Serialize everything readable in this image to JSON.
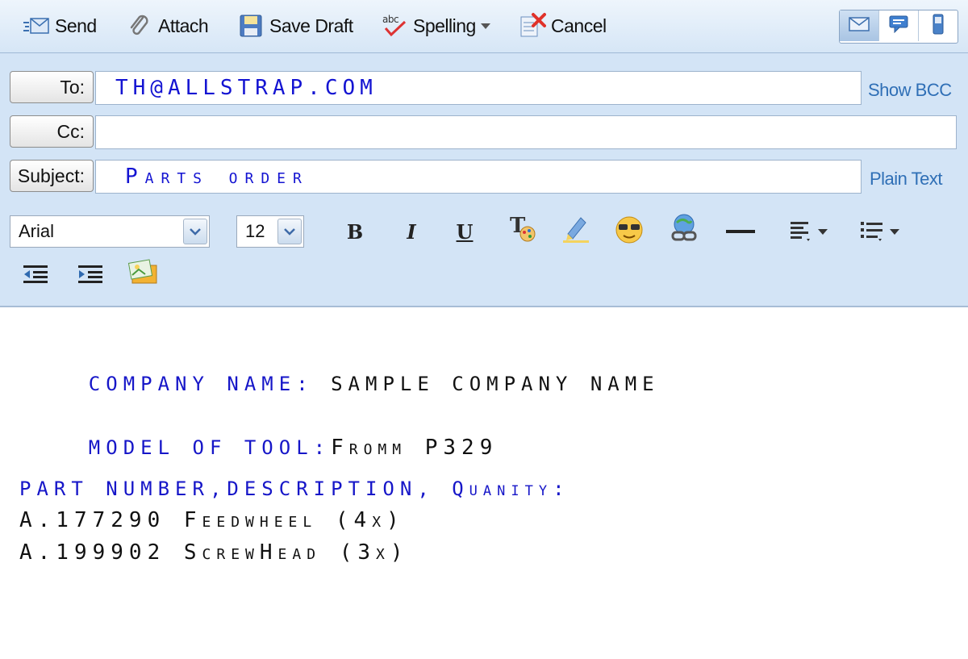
{
  "toolbar": {
    "send_label": "Send",
    "attach_label": "Attach",
    "save_draft_label": "Save Draft",
    "spelling_label": "Spelling",
    "cancel_label": "Cancel",
    "views": [
      "email-view-icon",
      "chat-view-icon",
      "mobile-view-icon"
    ]
  },
  "compose": {
    "to_label": "To:",
    "to_value": "TH@ALLSTRAP.COM",
    "cc_label": "Cc:",
    "cc_value": "",
    "subject_label": "Subject:",
    "subject_value": "Parts order",
    "show_bcc_label": "Show BCC",
    "plain_text_label": "Plain Text"
  },
  "format_bar": {
    "font": "Arial",
    "size": "12",
    "bold": "B",
    "italic": "I",
    "underline": "U",
    "tools": [
      "bold-icon",
      "italic-icon",
      "underline-icon",
      "text-color-icon",
      "highlight-icon",
      "emoticon-icon",
      "link-icon",
      "horizontal-rule-icon",
      "align-icon",
      "bullet-list-icon",
      "outdent-icon",
      "indent-icon",
      "insert-image-icon"
    ]
  },
  "message": {
    "company_label": "COMPANY NAME:",
    "company_value": "SAMPLE COMPANY NAME",
    "model_label": "MODEL OF TOOL:",
    "model_value": "Fromm P329",
    "parts_header": "PART NUMBER,DESCRIPTION, Quanity:",
    "parts": [
      "A.177290 Feedwheel (4x)",
      "A.199902 ScrewHead (3x)"
    ]
  },
  "colors": {
    "header_bg": "#d3e4f6",
    "link": "#2f6fb6",
    "body_blue": "#1616c8"
  }
}
